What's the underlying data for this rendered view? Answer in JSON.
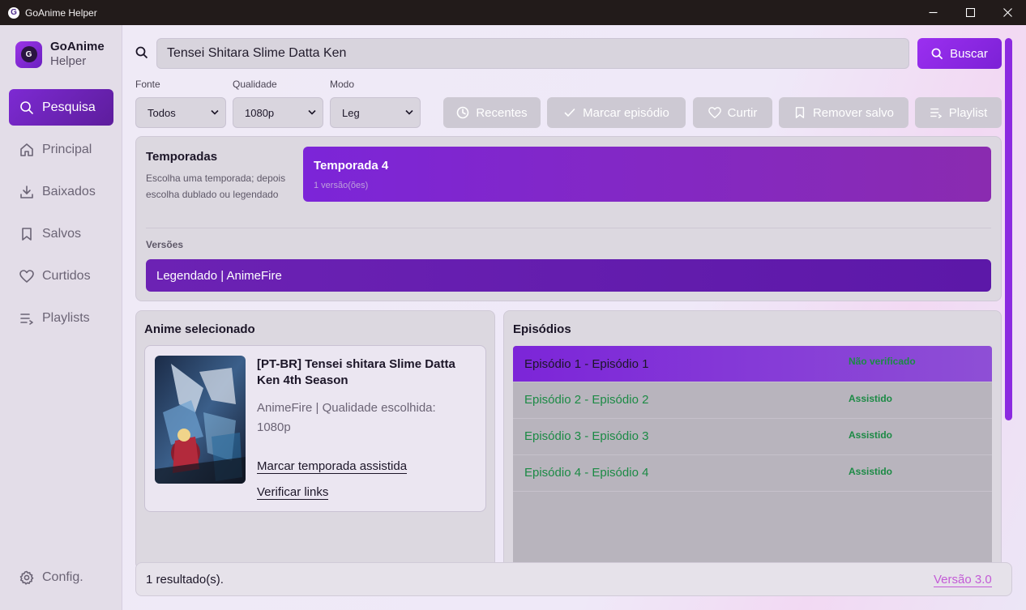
{
  "window": {
    "title": "GoAnime Helper",
    "logo_letter": "G"
  },
  "brand": {
    "name": "GoAnime",
    "sub": "Helper",
    "logo_letter": "G"
  },
  "sidebar": {
    "items": [
      {
        "label": "Pesquisa",
        "icon": "search-icon",
        "active": true
      },
      {
        "label": "Principal",
        "icon": "home-icon"
      },
      {
        "label": "Baixados",
        "icon": "download-icon"
      },
      {
        "label": "Salvos",
        "icon": "bookmark-icon"
      },
      {
        "label": "Curtidos",
        "icon": "heart-icon"
      },
      {
        "label": "Playlists",
        "icon": "playlist-icon"
      }
    ],
    "settings_label": "Config."
  },
  "search": {
    "value": "Tensei Shitara Slime Datta Ken",
    "button_label": "Buscar"
  },
  "filters": {
    "source": {
      "label": "Fonte",
      "value": "Todos"
    },
    "quality": {
      "label": "Qualidade",
      "value": "1080p"
    },
    "mode": {
      "label": "Modo",
      "value": "Leg"
    }
  },
  "actions": {
    "recent": "Recentes",
    "mark_episode": "Marcar episódio",
    "like": "Curtir",
    "remove_saved": "Remover salvo",
    "playlist": "Playlist"
  },
  "seasons": {
    "title": "Temporadas",
    "description": "Escolha uma temporada; depois escolha dublado ou legendado",
    "selected_season": {
      "title": "Temporada 4",
      "sub": "1 versão(ões)"
    },
    "versions_label": "Versões",
    "version": "Legendado | AnimeFire"
  },
  "anime": {
    "panel_title": "Anime selecionado",
    "name": "[PT-BR] Tensei shitara Slime Datta Ken 4th Season",
    "meta": "AnimeFire | Qualidade escolhida: 1080p",
    "mark_season_link": "Marcar temporada assistida",
    "verify_links": "Verificar links"
  },
  "episodes": {
    "panel_title": "Episódios",
    "items": [
      {
        "title": "Episódio 1 - Episódio 1",
        "status": "Não verificado",
        "selected": true
      },
      {
        "title": "Episódio 2 - Episódio 2",
        "status": "Assistido"
      },
      {
        "title": "Episódio 3 - Episódio 3",
        "status": "Assistido"
      },
      {
        "title": "Episódio 4 - Episódio 4",
        "status": "Assistido"
      }
    ]
  },
  "status": {
    "results": "1 resultado(s).",
    "version": "Versão 3.0"
  },
  "colors": {
    "accent": "#8b2ae0",
    "success": "#1c8a45",
    "link": "#c35bd6"
  }
}
